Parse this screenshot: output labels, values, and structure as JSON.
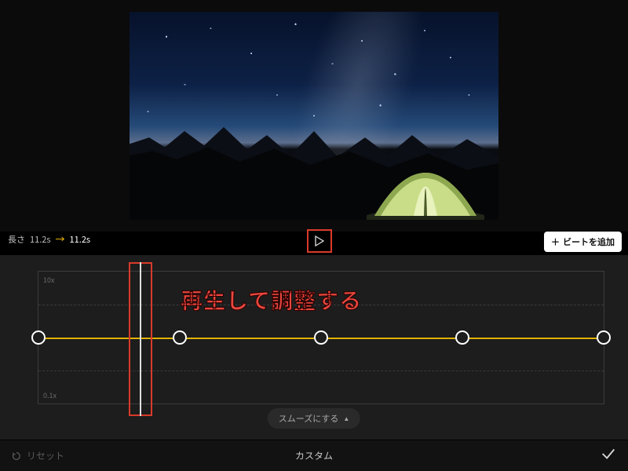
{
  "duration": {
    "prefix": "長さ",
    "original": "11.2s",
    "result": "11.2s"
  },
  "buttons": {
    "add_beat": "ビートを追加",
    "smooth": "スムーズにする",
    "reset": "リセット",
    "mode": "カスタム"
  },
  "annotation": "再生して調整する",
  "speed_graph": {
    "y_max_label": "10x",
    "y_min_label": "0.1x",
    "nodes": [
      0,
      0.25,
      0.5,
      0.75,
      1.0
    ],
    "playhead_position": 0.18
  },
  "colors": {
    "highlight_box": "#d93a2b",
    "curve_line": "#e0b200",
    "annotation_text": "#e8473e"
  }
}
